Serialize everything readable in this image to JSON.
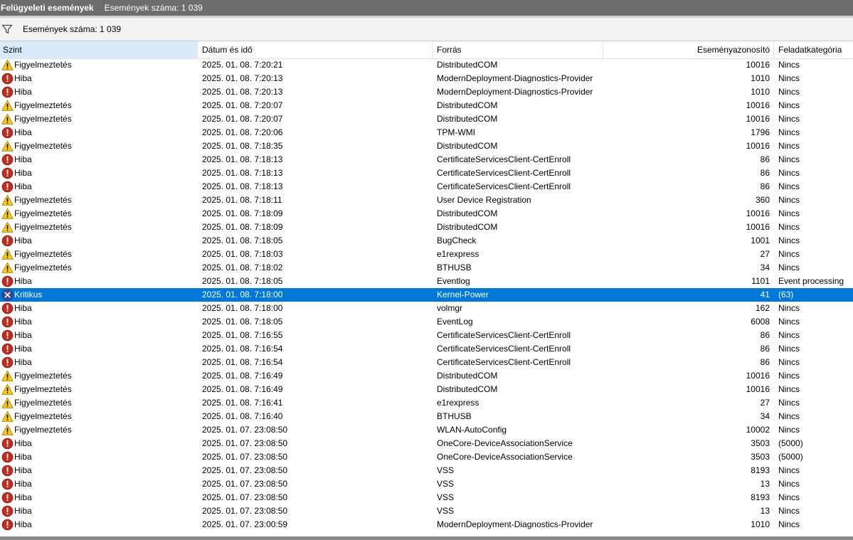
{
  "window": {
    "title": "Felügyeleti események",
    "count_label": "Események száma: 1 039"
  },
  "filter": {
    "icon": "filter-icon",
    "text": "Események száma: 1 039"
  },
  "columns": {
    "level": "Szint",
    "date": "Dátum és idő",
    "source": "Forrás",
    "event_id": "Eseményazonosító",
    "category": "Feladatkategória"
  },
  "colors": {
    "error": "#c42b1c",
    "warning": "#ffcc00",
    "critical": "#3c4a94",
    "selection": "#0078d7"
  },
  "rows": [
    {
      "type": "warning",
      "level": "Figyelmeztetés",
      "date": "2025. 01. 08. 7:20:21",
      "source": "DistributedCOM",
      "id": "10016",
      "category": "Nincs"
    },
    {
      "type": "error",
      "level": "Hiba",
      "date": "2025. 01. 08. 7:20:13",
      "source": "ModernDeployment-Diagnostics-Provider",
      "id": "1010",
      "category": "Nincs"
    },
    {
      "type": "error",
      "level": "Hiba",
      "date": "2025. 01. 08. 7:20:13",
      "source": "ModernDeployment-Diagnostics-Provider",
      "id": "1010",
      "category": "Nincs"
    },
    {
      "type": "warning",
      "level": "Figyelmeztetés",
      "date": "2025. 01. 08. 7:20:07",
      "source": "DistributedCOM",
      "id": "10016",
      "category": "Nincs"
    },
    {
      "type": "warning",
      "level": "Figyelmeztetés",
      "date": "2025. 01. 08. 7:20:07",
      "source": "DistributedCOM",
      "id": "10016",
      "category": "Nincs"
    },
    {
      "type": "error",
      "level": "Hiba",
      "date": "2025. 01. 08. 7:20:06",
      "source": "TPM-WMI",
      "id": "1796",
      "category": "Nincs"
    },
    {
      "type": "warning",
      "level": "Figyelmeztetés",
      "date": "2025. 01. 08. 7:18:35",
      "source": "DistributedCOM",
      "id": "10016",
      "category": "Nincs"
    },
    {
      "type": "error",
      "level": "Hiba",
      "date": "2025. 01. 08. 7:18:13",
      "source": "CertificateServicesClient-CertEnroll",
      "id": "86",
      "category": "Nincs"
    },
    {
      "type": "error",
      "level": "Hiba",
      "date": "2025. 01. 08. 7:18:13",
      "source": "CertificateServicesClient-CertEnroll",
      "id": "86",
      "category": "Nincs"
    },
    {
      "type": "error",
      "level": "Hiba",
      "date": "2025. 01. 08. 7:18:13",
      "source": "CertificateServicesClient-CertEnroll",
      "id": "86",
      "category": "Nincs"
    },
    {
      "type": "warning",
      "level": "Figyelmeztetés",
      "date": "2025. 01. 08. 7:18:11",
      "source": "User Device Registration",
      "id": "360",
      "category": "Nincs"
    },
    {
      "type": "warning",
      "level": "Figyelmeztetés",
      "date": "2025. 01. 08. 7:18:09",
      "source": "DistributedCOM",
      "id": "10016",
      "category": "Nincs"
    },
    {
      "type": "warning",
      "level": "Figyelmeztetés",
      "date": "2025. 01. 08. 7:18:09",
      "source": "DistributedCOM",
      "id": "10016",
      "category": "Nincs"
    },
    {
      "type": "error",
      "level": "Hiba",
      "date": "2025. 01. 08. 7:18:05",
      "source": "BugCheck",
      "id": "1001",
      "category": "Nincs"
    },
    {
      "type": "warning",
      "level": "Figyelmeztetés",
      "date": "2025. 01. 08. 7:18:03",
      "source": "e1rexpress",
      "id": "27",
      "category": "Nincs"
    },
    {
      "type": "warning",
      "level": "Figyelmeztetés",
      "date": "2025. 01. 08. 7:18:02",
      "source": "BTHUSB",
      "id": "34",
      "category": "Nincs"
    },
    {
      "type": "error",
      "level": "Hiba",
      "date": "2025. 01. 08. 7:18:05",
      "source": "Eventlog",
      "id": "1101",
      "category": "Event processing"
    },
    {
      "type": "critical",
      "level": "Kritikus",
      "date": "2025. 01. 08. 7:18:00",
      "source": "Kernel-Power",
      "id": "41",
      "category": "(63)",
      "selected": true
    },
    {
      "type": "error",
      "level": "Hiba",
      "date": "2025. 01. 08. 7:18:00",
      "source": "volmgr",
      "id": "162",
      "category": "Nincs"
    },
    {
      "type": "error",
      "level": "Hiba",
      "date": "2025. 01. 08. 7:18:05",
      "source": "EventLog",
      "id": "6008",
      "category": "Nincs"
    },
    {
      "type": "error",
      "level": "Hiba",
      "date": "2025. 01. 08. 7:16:55",
      "source": "CertificateServicesClient-CertEnroll",
      "id": "86",
      "category": "Nincs"
    },
    {
      "type": "error",
      "level": "Hiba",
      "date": "2025. 01. 08. 7:16:54",
      "source": "CertificateServicesClient-CertEnroll",
      "id": "86",
      "category": "Nincs"
    },
    {
      "type": "error",
      "level": "Hiba",
      "date": "2025. 01. 08. 7:16:54",
      "source": "CertificateServicesClient-CertEnroll",
      "id": "86",
      "category": "Nincs"
    },
    {
      "type": "warning",
      "level": "Figyelmeztetés",
      "date": "2025. 01. 08. 7:16:49",
      "source": "DistributedCOM",
      "id": "10016",
      "category": "Nincs"
    },
    {
      "type": "warning",
      "level": "Figyelmeztetés",
      "date": "2025. 01. 08. 7:16:49",
      "source": "DistributedCOM",
      "id": "10016",
      "category": "Nincs"
    },
    {
      "type": "warning",
      "level": "Figyelmeztetés",
      "date": "2025. 01. 08. 7:16:41",
      "source": "e1rexpress",
      "id": "27",
      "category": "Nincs"
    },
    {
      "type": "warning",
      "level": "Figyelmeztetés",
      "date": "2025. 01. 08. 7:16:40",
      "source": "BTHUSB",
      "id": "34",
      "category": "Nincs"
    },
    {
      "type": "warning",
      "level": "Figyelmeztetés",
      "date": "2025. 01. 07. 23:08:50",
      "source": "WLAN-AutoConfig",
      "id": "10002",
      "category": "Nincs"
    },
    {
      "type": "error",
      "level": "Hiba",
      "date": "2025. 01. 07. 23:08:50",
      "source": "OneCore-DeviceAssociationService",
      "id": "3503",
      "category": "(5000)"
    },
    {
      "type": "error",
      "level": "Hiba",
      "date": "2025. 01. 07. 23:08:50",
      "source": "OneCore-DeviceAssociationService",
      "id": "3503",
      "category": "(5000)"
    },
    {
      "type": "error",
      "level": "Hiba",
      "date": "2025. 01. 07. 23:08:50",
      "source": "VSS",
      "id": "8193",
      "category": "Nincs"
    },
    {
      "type": "error",
      "level": "Hiba",
      "date": "2025. 01. 07. 23:08:50",
      "source": "VSS",
      "id": "13",
      "category": "Nincs"
    },
    {
      "type": "error",
      "level": "Hiba",
      "date": "2025. 01. 07. 23:08:50",
      "source": "VSS",
      "id": "8193",
      "category": "Nincs"
    },
    {
      "type": "error",
      "level": "Hiba",
      "date": "2025. 01. 07. 23:08:50",
      "source": "VSS",
      "id": "13",
      "category": "Nincs"
    },
    {
      "type": "error",
      "level": "Hiba",
      "date": "2025. 01. 07. 23:00:59",
      "source": "ModernDeployment-Diagnostics-Provider",
      "id": "1010",
      "category": "Nincs"
    }
  ]
}
